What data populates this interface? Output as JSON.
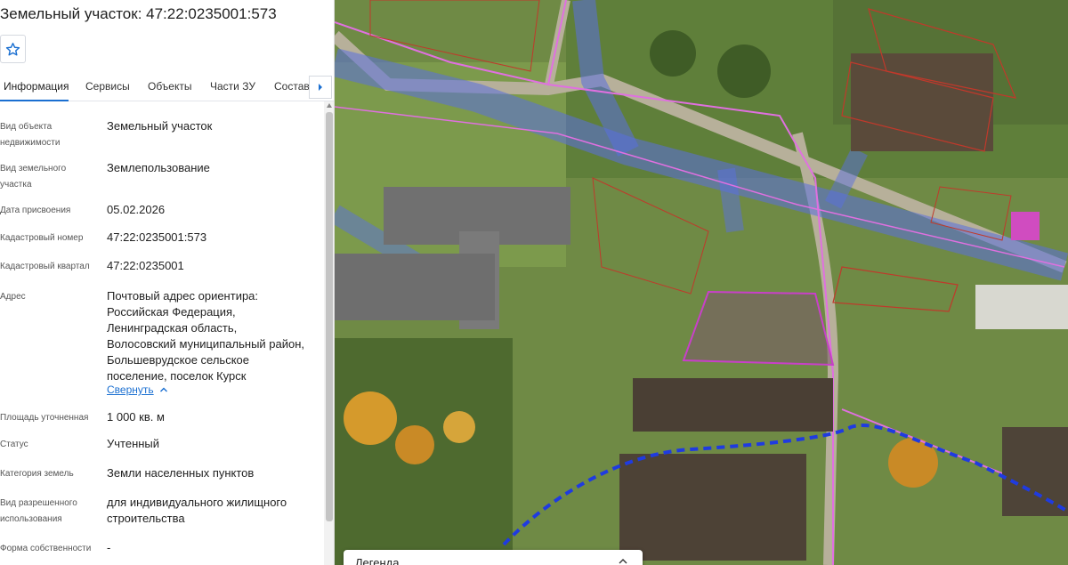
{
  "header": {
    "title": "Земельный участок: 47:22:0235001:573",
    "favorite_icon": "star-icon"
  },
  "tabs": [
    {
      "label": "Информация",
      "active": true
    },
    {
      "label": "Сервисы"
    },
    {
      "label": "Объекты"
    },
    {
      "label": "Части ЗУ"
    },
    {
      "label": "Состав"
    }
  ],
  "tabs_next_icon": "chevron-right-icon",
  "info": {
    "object_type": {
      "label": "Вид объекта недвижимости",
      "value": "Земельный участок"
    },
    "land_plot_type": {
      "label": "Вид земельного участка",
      "value": "Землепользование"
    },
    "assignment_date": {
      "label": "Дата присвоения",
      "value": "05.02.2026"
    },
    "cadastral_number": {
      "label": "Кадастровый номер",
      "value": "47:22:0235001:573"
    },
    "cadastral_quarter": {
      "label": "Кадастровый квартал",
      "value": "47:22:0235001"
    },
    "address": {
      "label": "Адрес",
      "lines": [
        "Почтовый адрес ориентира:",
        "Российская Федерация,",
        "Ленинградская область,",
        "Волосовский муниципальный район,",
        "Большеврудское сельское",
        "поселение, поселок Курск"
      ],
      "collapse_label": "Свернуть"
    },
    "area": {
      "label": "Площадь уточненная",
      "value": "1 000 кв. м"
    },
    "status": {
      "label": "Статус",
      "value": "Учтенный"
    },
    "land_category": {
      "label": "Категория земель",
      "value": "Земли населенных пунктов"
    },
    "permitted_use": {
      "label": "Вид разрешенного использования",
      "lines": [
        "для индивидуального жилищного",
        "строительства"
      ]
    },
    "ownership_form": {
      "label": "Форма собственности",
      "value": "-"
    }
  },
  "map": {
    "legend_title": "Легенда",
    "colors": {
      "parcel_selected": "#c840c8",
      "parcel_border": "#c0392b",
      "road": "#e070e0",
      "zone_blue": "#5a6fe0",
      "boundary_dashed": "#1f3be0",
      "link": "#1a6fd1"
    }
  }
}
